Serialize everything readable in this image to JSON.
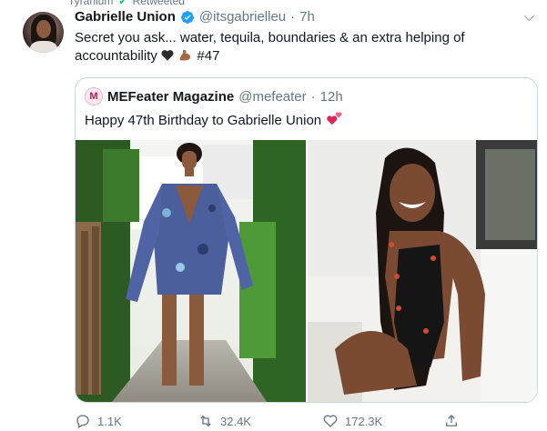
{
  "context": {
    "left": "Tyranium",
    "right": "Retweeted"
  },
  "tweet": {
    "name": "Gabrielle Union",
    "handle": "@itsgabrielleu",
    "separator": "·",
    "time": "7h",
    "text": "Secret you ask... water, tequila, boundaries & an extra helping of accountability",
    "text_tail": "#47"
  },
  "quote": {
    "avatar_letter": "M",
    "name": "MEFeater Magazine",
    "handle": "@mefeater",
    "separator": "·",
    "time": "12h",
    "text": "Happy 47th Birthday to Gabrielle Union"
  },
  "actions": {
    "replies": "1.1K",
    "retweets": "32.4K",
    "likes": "172.3K"
  },
  "colors": {
    "verified": "#1da1f2",
    "muted": "#657786",
    "border": "#ccd6dd"
  }
}
